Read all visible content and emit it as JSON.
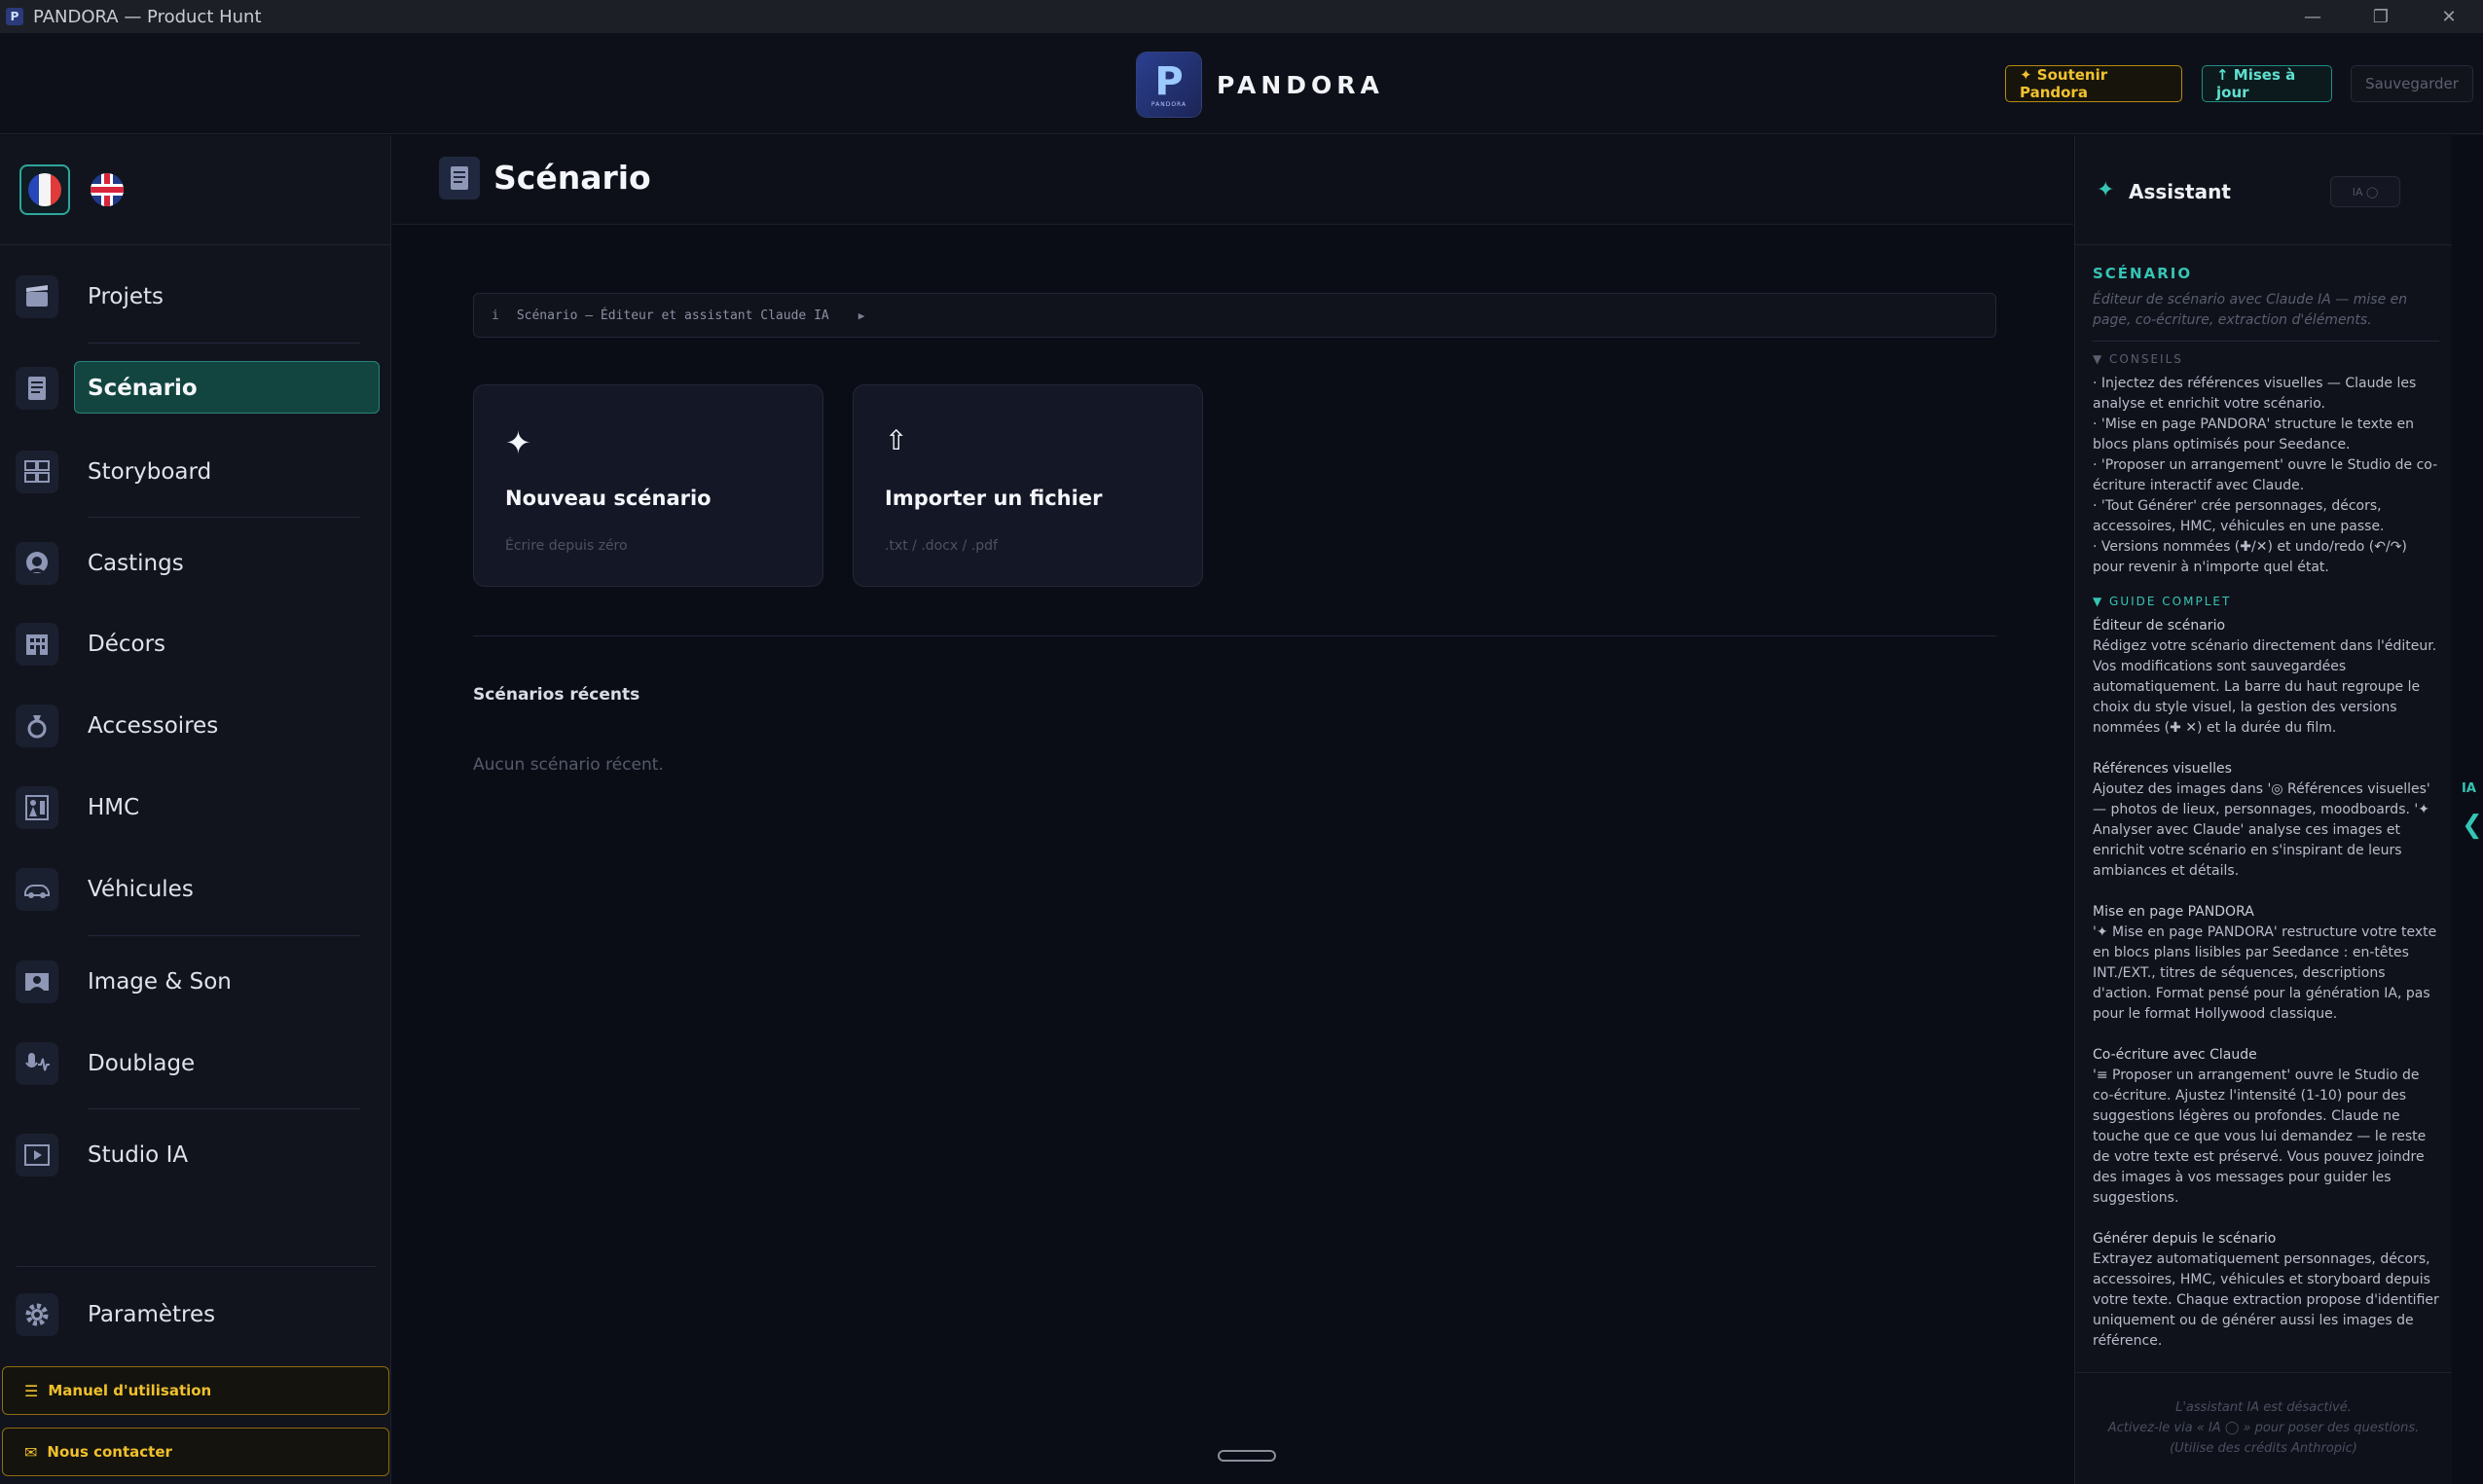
{
  "window": {
    "title": "PANDORA — Product Hunt",
    "minimize": "—",
    "restore": "❐",
    "close": "✕"
  },
  "header": {
    "brand_name": "PANDORA",
    "logo_letter": "P",
    "logo_sub": "PANDORA",
    "support_label": "✦ Soutenir Pandora",
    "updates_label": "↑ Mises à jour",
    "save_label": "Sauvegarder",
    "colors": {
      "support": "#f2c230",
      "updates": "#5fe0d0"
    }
  },
  "sidebar": {
    "items": [
      {
        "label": "Projets",
        "icon": "clapperboard-icon"
      },
      {
        "label": "Scénario",
        "icon": "document-icon",
        "active": true
      },
      {
        "label": "Storyboard",
        "icon": "storyboard-icon"
      },
      {
        "label": "Castings",
        "icon": "person-icon"
      },
      {
        "label": "Décors",
        "icon": "building-icon"
      },
      {
        "label": "Accessoires",
        "icon": "ring-icon"
      },
      {
        "label": "HMC",
        "icon": "costume-icon"
      },
      {
        "label": "Véhicules",
        "icon": "car-icon"
      },
      {
        "label": "Image & Son",
        "icon": "camera-icon"
      },
      {
        "label": "Doublage",
        "icon": "microphone-icon"
      },
      {
        "label": "Studio IA",
        "icon": "studio-icon"
      },
      {
        "label": "Paramètres",
        "icon": "gear-icon"
      }
    ],
    "manual_label": "Manuel d'utilisation",
    "contact_label": "Nous contacter",
    "accent_color": "#27857a"
  },
  "main": {
    "title": "Scénario",
    "info_bar": "Scénario — Éditeur et assistant Claude IA",
    "info_icon": "i",
    "info_arrow": "▶",
    "cards": [
      {
        "title": "Nouveau scénario",
        "subtitle": "Écrire depuis zéro",
        "icon": "sparkle-icon",
        "glyph": "✦"
      },
      {
        "title": "Importer un fichier",
        "subtitle": ".txt / .docx / .pdf",
        "icon": "upload-icon",
        "glyph": "⇧"
      }
    ],
    "recent_title": "Scénarios récents",
    "recent_empty": "Aucun scénario récent."
  },
  "assistant": {
    "title": "Assistant",
    "spark": "✦",
    "toggle_label": "IA ◯",
    "section": "SCÉNARIO",
    "description": "Éditeur de scénario avec Claude IA — mise en page, co-écriture, extraction d'éléments.",
    "tips_title": "▼  CONSEILS",
    "tips": [
      "· Injectez des références visuelles — Claude les analyse et enrichit votre scénario.",
      "· 'Mise en page PANDORA' structure le texte en blocs plans optimisés pour Seedance.",
      "· 'Proposer un arrangement' ouvre le Studio de co-écriture interactif avec Claude.",
      "· 'Tout Générer' crée personnages, décors, accessoires, HMC, véhicules en une passe.",
      "· Versions nommées (✚/✕) et undo/redo (↶/↷) pour revenir à n'importe quel état."
    ],
    "guide_title": "▼  GUIDE COMPLET",
    "guide": [
      {
        "heading": "Éditeur de scénario",
        "body": "Rédigez votre scénario directement dans l'éditeur. Vos modifications sont sauvegardées automatiquement. La barre du haut regroupe le choix du style visuel, la gestion des versions nommées (✚ ✕) et la durée du film."
      },
      {
        "heading": "Références visuelles",
        "body": "Ajoutez des images dans '◎ Références visuelles' — photos de lieux, personnages, moodboards. '✦ Analyser avec Claude' analyse ces images et enrichit votre scénario en s'inspirant de leurs ambiances et détails."
      },
      {
        "heading": "Mise en page PANDORA",
        "body": "'✦ Mise en page PANDORA' restructure votre texte en blocs plans lisibles par Seedance : en-têtes INT./EXT., titres de séquences, descriptions d'action. Format pensé pour la génération IA, pas pour le format Hollywood classique."
      },
      {
        "heading": "Co-écriture avec Claude",
        "body": "'≡ Proposer un arrangement' ouvre le Studio de co-écriture. Ajustez l'intensité (1-10) pour des suggestions légères ou profondes. Claude ne touche que ce que vous lui demandez — le reste de votre texte est préservé. Vous pouvez joindre des images à vos messages pour guider les suggestions."
      },
      {
        "heading": "Générer depuis le scénario",
        "body": "Extrayez automatiquement personnages, décors, accessoires, HMC, véhicules et storyboard depuis votre texte. Chaque extraction propose d'identifier uniquement ou de générer aussi les images de référence."
      }
    ],
    "footer": [
      "L'assistant IA est désactivé.",
      "Activez-le via « IA ◯ » pour poser des questions.",
      "(Utilise des crédits Anthropic)"
    ]
  },
  "edge_tab": {
    "label": "IA",
    "chevron": "❮"
  }
}
